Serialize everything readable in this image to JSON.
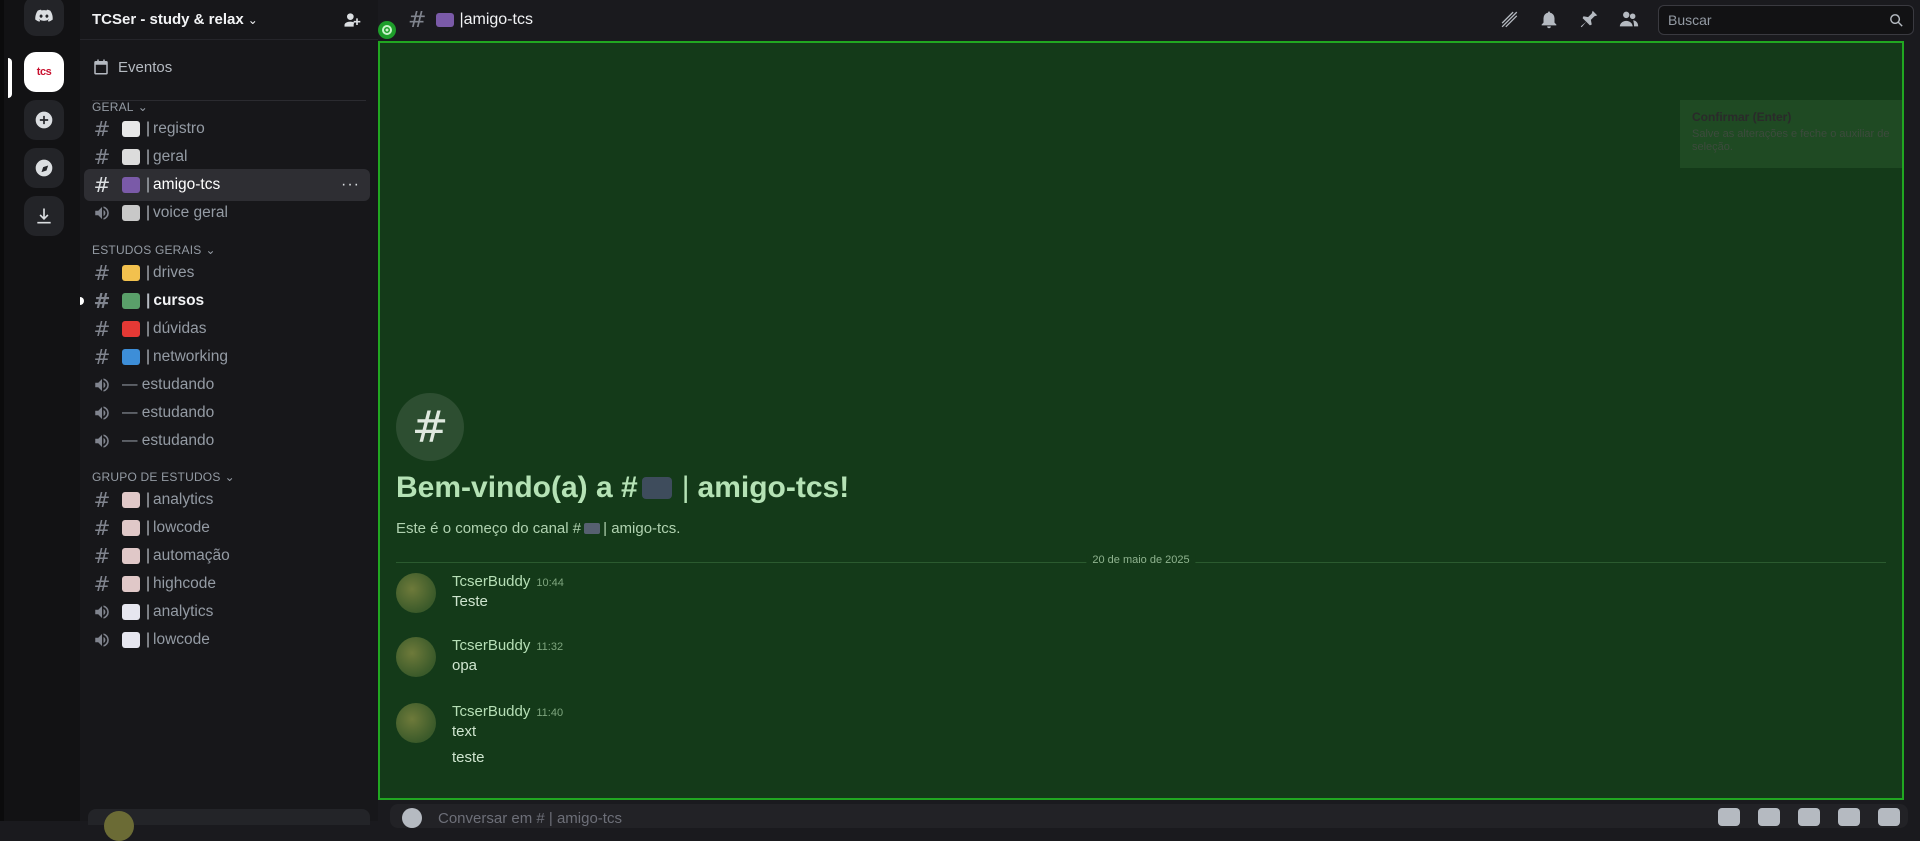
{
  "server": {
    "name": "TCSer - study & relax"
  },
  "sidebar": {
    "events_label": "Eventos",
    "categories": [
      {
        "label": "GERAL"
      },
      {
        "label": "ESTUDOS GERAIS"
      },
      {
        "label": "GRUPO DE ESTUDOS"
      }
    ],
    "channels": [
      {
        "name": "registro",
        "type": "text",
        "emoji_color": "#e8e8e8"
      },
      {
        "name": "geral",
        "type": "text",
        "emoji_color": "#dcdcdc"
      },
      {
        "name": "amigo-tcs",
        "type": "text",
        "emoji_color": "#7a5aa8",
        "active": true
      },
      {
        "name": "voice geral",
        "type": "voice",
        "emoji_color": "#c8c8c8"
      },
      {
        "name": "drives",
        "type": "text",
        "emoji_color": "#f2c14e"
      },
      {
        "name": "cursos",
        "type": "text",
        "emoji_color": "#5aa06a",
        "unread": true
      },
      {
        "name": "dúvidas",
        "type": "text",
        "emoji_color": "#e53935"
      },
      {
        "name": "networking",
        "type": "text",
        "emoji_color": "#3d8ed8"
      },
      {
        "name": "— estudando",
        "type": "voice"
      },
      {
        "name": "— estudando",
        "type": "voice"
      },
      {
        "name": "— estudando",
        "type": "voice"
      },
      {
        "name": "analytics",
        "type": "text",
        "emoji_color": "#e0c8c8"
      },
      {
        "name": "lowcode",
        "type": "text",
        "emoji_color": "#e0c8c8"
      },
      {
        "name": "automação",
        "type": "text",
        "emoji_color": "#e0c8c8"
      },
      {
        "name": "highcode",
        "type": "text",
        "emoji_color": "#e0c8c8"
      },
      {
        "name": "analytics",
        "type": "voice",
        "emoji_color": "#e6e6ef"
      },
      {
        "name": "lowcode",
        "type": "voice",
        "emoji_color": "#e6e6ef"
      }
    ]
  },
  "channel": {
    "name": "amigo-tcs",
    "search_placeholder": "Buscar",
    "welcome_title_prefix": "Bem-vindo(a) a #",
    "welcome_title_suffix": "amigo-tcs!",
    "welcome_sub_prefix": "Este é o começo do canal #",
    "welcome_sub_suffix": "amigo-tcs.",
    "date_divider": "20 de maio de 2025",
    "composer_placeholder": "Conversar em #",
    "composer_channel": "amigo-tcs"
  },
  "tooltip": {
    "title": "Confirmar (Enter)",
    "text": "Salve as alterações e feche o auxiliar de seleção."
  },
  "messages": [
    {
      "author": "TcserBuddy",
      "time": "10:44",
      "lines": [
        "Teste"
      ]
    },
    {
      "author": "TcserBuddy",
      "time": "11:32",
      "lines": [
        "opa"
      ]
    },
    {
      "author": "TcserBuddy",
      "time": "11:40",
      "lines": [
        "text",
        "teste"
      ]
    }
  ],
  "colors": {
    "overlay_fill": "#143a19",
    "overlay_border": "#21a721",
    "accent": "#5865f2"
  }
}
